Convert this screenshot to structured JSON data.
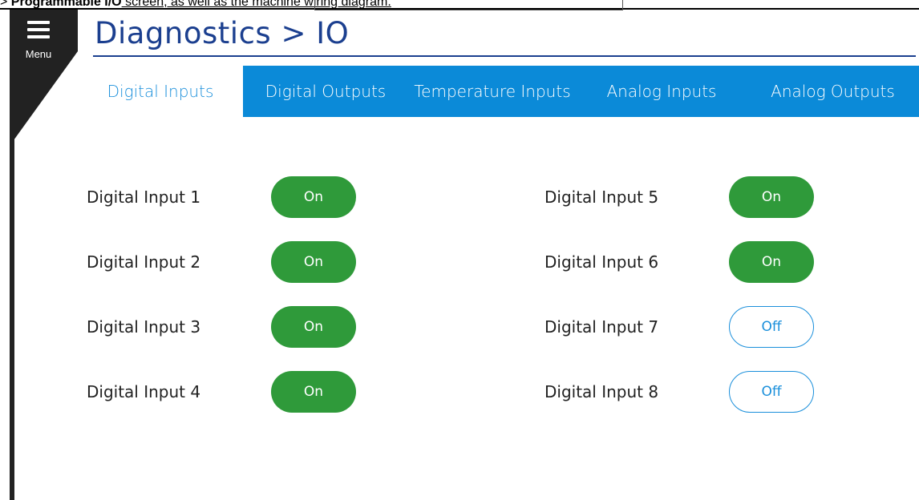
{
  "doc_caption": {
    "prefix": "> ",
    "bold": "Programmable I/O",
    "rest": " screen, as well as the machine wiring diagram."
  },
  "menu": {
    "label": "Menu",
    "icon": "hamburger-icon"
  },
  "header": {
    "title": "Diagnostics > IO"
  },
  "tabs": [
    {
      "label": "Digital Inputs",
      "active": true
    },
    {
      "label": "Digital Outputs",
      "active": false
    },
    {
      "label": "Temperature Inputs",
      "active": false
    },
    {
      "label": "Analog Inputs",
      "active": false
    },
    {
      "label": "Analog Outputs",
      "active": false
    }
  ],
  "inputs": [
    {
      "label": "Digital Input 1",
      "state": "On"
    },
    {
      "label": "Digital Input 2",
      "state": "On"
    },
    {
      "label": "Digital Input 3",
      "state": "On"
    },
    {
      "label": "Digital Input 4",
      "state": "On"
    },
    {
      "label": "Digital Input 5",
      "state": "On"
    },
    {
      "label": "Digital Input 6",
      "state": "On"
    },
    {
      "label": "Digital Input 7",
      "state": "Off"
    },
    {
      "label": "Digital Input 8",
      "state": "Off"
    }
  ],
  "colors": {
    "on": "#2f9a3a",
    "off_border": "#1a8fdb",
    "tab_bg": "#0b8ad8",
    "title": "#1b3f8f",
    "rail": "#222222"
  }
}
